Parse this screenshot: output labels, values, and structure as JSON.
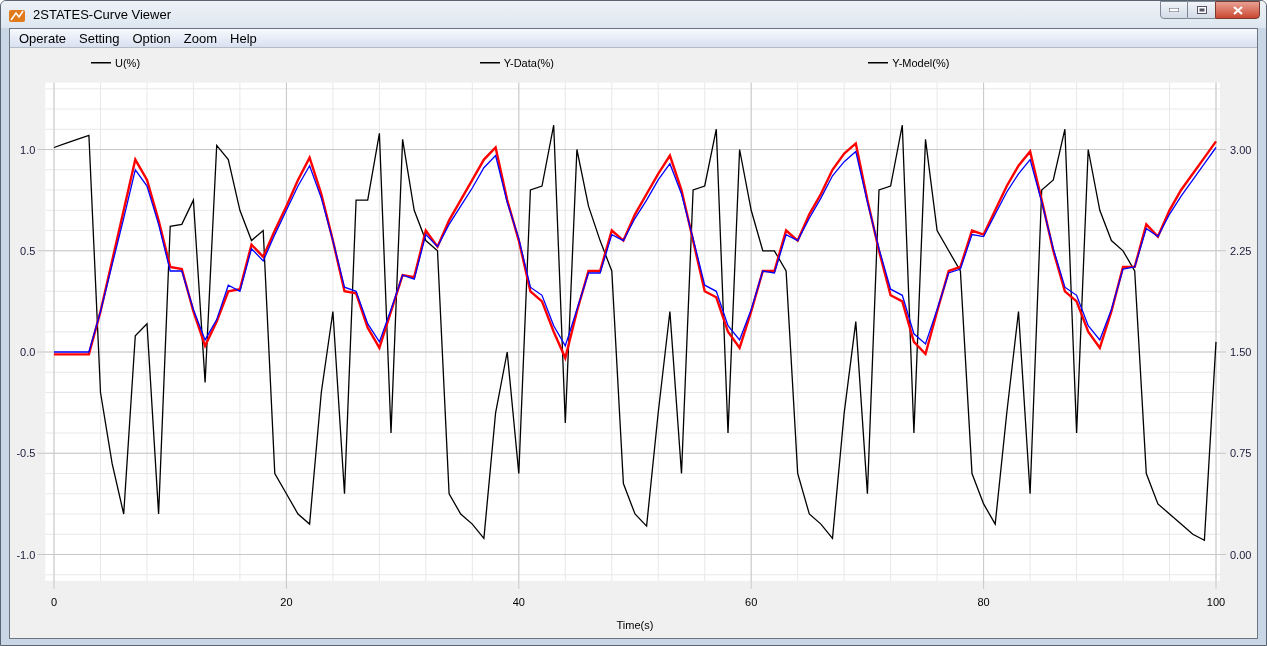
{
  "window": {
    "title": "2STATES-Curve Viewer"
  },
  "menu": [
    {
      "label": "Operate"
    },
    {
      "label": "Setting"
    },
    {
      "label": "Option"
    },
    {
      "label": "Zoom"
    },
    {
      "label": "Help"
    }
  ],
  "chart": {
    "right_axis_labels": [
      "3.00",
      "2.25",
      "1.50",
      "0.75",
      "0.00"
    ],
    "chart_data": {
      "type": "line",
      "grid": true,
      "xlabel": "Time(s)",
      "xlim": [
        -0.4,
        100
      ],
      "ylim": [
        -1.13,
        1.33
      ],
      "xticks": [
        0,
        20,
        40,
        60,
        80,
        100
      ],
      "yticks": [
        {
          "value": 1,
          "label": "1.0"
        },
        {
          "value": 0.5,
          "label": "0.5"
        },
        {
          "value": 0,
          "label": "0.0"
        },
        {
          "value": -0.5,
          "label": "-0.5"
        },
        {
          "value": -1,
          "label": "-1.0"
        }
      ],
      "x": [
        0,
        1,
        2,
        3,
        4,
        5,
        6,
        7,
        8,
        9,
        10,
        11,
        12,
        13,
        14,
        15,
        16,
        17,
        18,
        19,
        20,
        21,
        22,
        23,
        24,
        25,
        26,
        27,
        28,
        29,
        30,
        31,
        32,
        33,
        34,
        35,
        36,
        37,
        38,
        39,
        40,
        41,
        42,
        43,
        44,
        45,
        46,
        47,
        48,
        49,
        50,
        51,
        52,
        53,
        54,
        55,
        56,
        57,
        58,
        59,
        60,
        61,
        62,
        63,
        64,
        65,
        66,
        67,
        68,
        69,
        70,
        71,
        72,
        73,
        74,
        75,
        76,
        77,
        78,
        79,
        80,
        81,
        82,
        83,
        84,
        85,
        86,
        87,
        88,
        89,
        90,
        91,
        92,
        93,
        94,
        95,
        96,
        97,
        98,
        99,
        100
      ],
      "series": [
        {
          "name": "U(%)",
          "color": "#000000",
          "values": [
            1.01,
            1.03,
            1.05,
            1.07,
            -0.2,
            -0.55,
            -0.8,
            0.08,
            0.14,
            -0.8,
            0.62,
            0.63,
            0.75,
            -0.15,
            1.02,
            0.95,
            0.7,
            0.55,
            0.6,
            -0.6,
            -0.7,
            -0.8,
            -0.85,
            -0.2,
            0.2,
            -0.7,
            0.75,
            0.75,
            1.08,
            -0.4,
            1.05,
            0.7,
            0.55,
            0.5,
            -0.7,
            -0.8,
            -0.85,
            -0.92,
            -0.3,
            0.0,
            -0.6,
            0.8,
            0.82,
            1.12,
            -0.35,
            1.0,
            0.72,
            0.55,
            0.4,
            -0.65,
            -0.8,
            -0.86,
            -0.3,
            0.2,
            -0.6,
            0.8,
            0.82,
            1.1,
            -0.4,
            1.0,
            0.7,
            0.5,
            0.5,
            0.4,
            -0.6,
            -0.8,
            -0.85,
            -0.92,
            -0.3,
            0.15,
            -0.7,
            0.8,
            0.82,
            1.12,
            -0.4,
            1.05,
            0.6,
            0.5,
            0.4,
            -0.6,
            -0.75,
            -0.85,
            -0.3,
            0.2,
            -0.7,
            0.8,
            0.85,
            1.1,
            -0.4,
            1.0,
            0.7,
            0.55,
            0.5,
            0.4,
            -0.6,
            -0.75,
            -0.8,
            -0.85,
            -0.9,
            -0.93,
            0.05
          ]
        },
        {
          "name": "Y-Data(%)",
          "color": "#ff0000",
          "values": [
            -0.012,
            -0.012,
            -0.012,
            -0.012,
            0.2,
            0.45,
            0.7,
            0.95,
            0.85,
            0.65,
            0.42,
            0.41,
            0.2,
            0.03,
            0.15,
            0.3,
            0.31,
            0.53,
            0.47,
            0.6,
            0.72,
            0.85,
            0.96,
            0.78,
            0.55,
            0.3,
            0.29,
            0.12,
            0.02,
            0.2,
            0.38,
            0.37,
            0.6,
            0.52,
            0.65,
            0.75,
            0.85,
            0.95,
            1.01,
            0.75,
            0.55,
            0.3,
            0.25,
            0.1,
            -0.03,
            0.2,
            0.4,
            0.4,
            0.6,
            0.55,
            0.68,
            0.78,
            0.88,
            0.97,
            0.8,
            0.55,
            0.3,
            0.27,
            0.1,
            0.02,
            0.2,
            0.4,
            0.4,
            0.6,
            0.55,
            0.68,
            0.78,
            0.9,
            0.98,
            1.03,
            0.75,
            0.5,
            0.28,
            0.25,
            0.05,
            -0.01,
            0.2,
            0.4,
            0.42,
            0.6,
            0.58,
            0.7,
            0.82,
            0.92,
            0.99,
            0.75,
            0.5,
            0.3,
            0.25,
            0.1,
            0.02,
            0.2,
            0.42,
            0.42,
            0.63,
            0.57,
            0.7,
            0.8,
            0.88,
            0.96,
            1.04
          ]
        },
        {
          "name": "Y-Model(%)",
          "color": "#0000ff",
          "values": [
            0,
            0,
            0,
            0,
            0.2,
            0.43,
            0.66,
            0.9,
            0.82,
            0.63,
            0.4,
            0.4,
            0.21,
            0.06,
            0.16,
            0.33,
            0.3,
            0.51,
            0.45,
            0.58,
            0.7,
            0.82,
            0.92,
            0.76,
            0.55,
            0.32,
            0.3,
            0.14,
            0.05,
            0.21,
            0.38,
            0.36,
            0.58,
            0.52,
            0.63,
            0.72,
            0.81,
            0.91,
            0.97,
            0.74,
            0.56,
            0.32,
            0.28,
            0.13,
            0.03,
            0.21,
            0.39,
            0.39,
            0.58,
            0.55,
            0.66,
            0.75,
            0.85,
            0.93,
            0.78,
            0.56,
            0.33,
            0.3,
            0.13,
            0.06,
            0.21,
            0.4,
            0.39,
            0.58,
            0.55,
            0.66,
            0.76,
            0.87,
            0.94,
            0.99,
            0.74,
            0.51,
            0.31,
            0.28,
            0.09,
            0.04,
            0.21,
            0.39,
            0.41,
            0.58,
            0.57,
            0.68,
            0.79,
            0.88,
            0.95,
            0.74,
            0.51,
            0.32,
            0.28,
            0.13,
            0.06,
            0.21,
            0.41,
            0.42,
            0.61,
            0.57,
            0.68,
            0.77,
            0.85,
            0.93,
            1.01
          ]
        }
      ]
    }
  }
}
